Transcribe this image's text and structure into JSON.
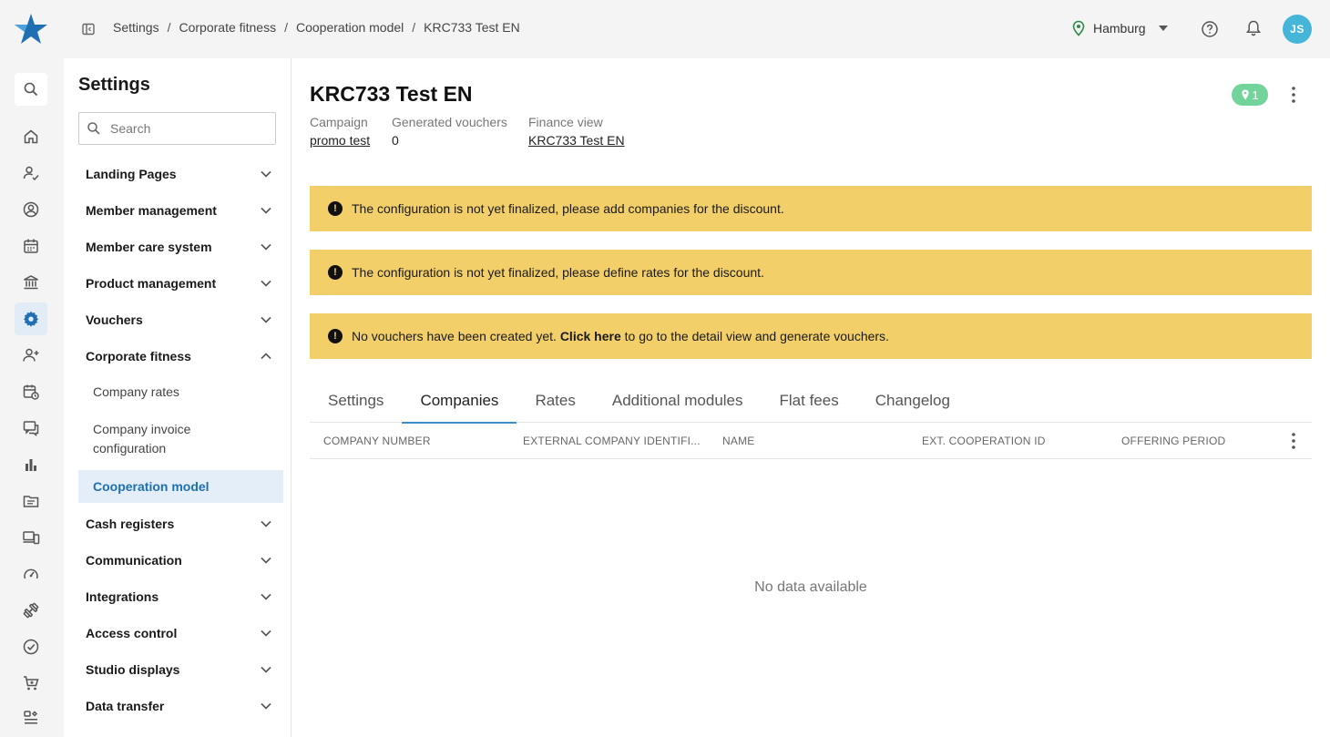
{
  "breadcrumb": [
    "Settings",
    "Corporate fitness",
    "Cooperation model",
    "KRC733 Test EN"
  ],
  "breadcrumb_separator": "/",
  "location": {
    "name": "Hamburg"
  },
  "user": {
    "initials": "JS"
  },
  "rail_icons": [
    "search-icon",
    "home-icon",
    "member-check-icon",
    "member-icon",
    "calendar-icon",
    "bank-icon",
    "settings-icon",
    "add-member-icon",
    "schedule-icon",
    "chat-icon",
    "chart-icon",
    "folder-icon",
    "devices-icon",
    "dashboard-icon",
    "dumbbell-icon",
    "check-circle-icon",
    "cart-icon",
    "more-icon"
  ],
  "settings": {
    "title": "Settings",
    "search_placeholder": "Search",
    "nav": [
      {
        "label": "Landing Pages",
        "expanded": false
      },
      {
        "label": "Member management",
        "expanded": false
      },
      {
        "label": "Member care system",
        "expanded": false
      },
      {
        "label": "Product management",
        "expanded": false
      },
      {
        "label": "Vouchers",
        "expanded": false
      },
      {
        "label": "Corporate fitness",
        "expanded": true
      },
      {
        "label": "Cash registers",
        "expanded": false
      },
      {
        "label": "Communication",
        "expanded": false
      },
      {
        "label": "Integrations",
        "expanded": false
      },
      {
        "label": "Access control",
        "expanded": false
      },
      {
        "label": "Studio displays",
        "expanded": false
      },
      {
        "label": "Data transfer",
        "expanded": false
      }
    ],
    "sub_items": [
      {
        "label": "Company rates",
        "active": false
      },
      {
        "label": "Company invoice configuration",
        "active": false
      },
      {
        "label": "Cooperation model",
        "active": true
      }
    ]
  },
  "page": {
    "title": "KRC733 Test EN",
    "badge_count": "1",
    "meta": {
      "campaign_label": "Campaign",
      "campaign_value": "promo test",
      "vouchers_label": "Generated vouchers",
      "vouchers_value": "0",
      "finance_label": "Finance view",
      "finance_value": "KRC733 Test EN"
    },
    "alerts": [
      {
        "text": "The configuration is not yet finalized, please add companies for the discount."
      },
      {
        "text": "The configuration is not yet finalized, please define rates for the discount."
      },
      {
        "text_before": "No vouchers have been created yet. ",
        "link": "Click here",
        "text_after": " to go to the detail view and generate vouchers."
      }
    ],
    "tabs": [
      "Settings",
      "Companies",
      "Rates",
      "Additional modules",
      "Flat fees",
      "Changelog"
    ],
    "active_tab": "Companies",
    "table": {
      "columns": [
        "Company number",
        "External company identifi...",
        "Name",
        "Ext. cooperation ID",
        "Offering period"
      ],
      "rows": [],
      "empty_text": "No data available"
    }
  },
  "colors": {
    "accent": "#3d8fc9",
    "alert_bg": "#f3cf69",
    "badge": "#72d49a",
    "avatar": "#45b5d9",
    "active_nav_bg": "#e4eef8"
  }
}
